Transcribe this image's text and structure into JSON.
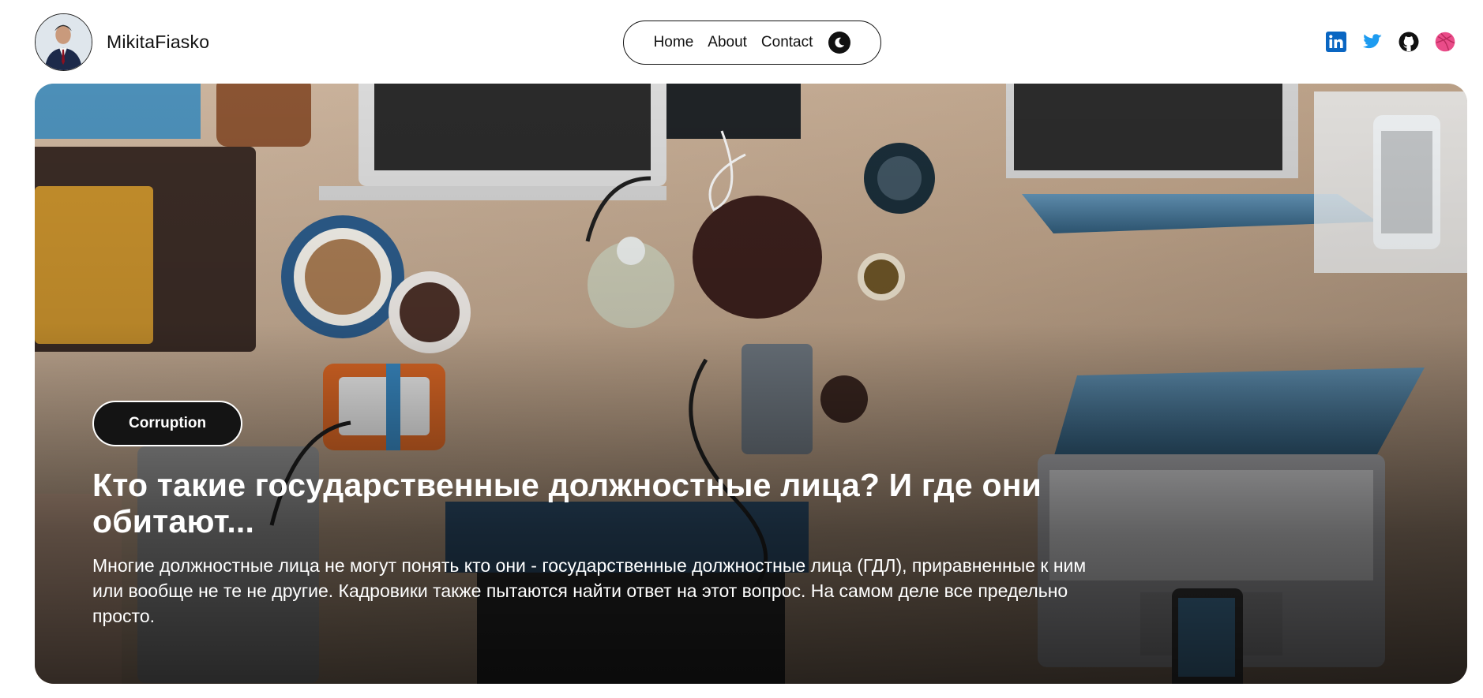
{
  "header": {
    "brand_name": "MikitaFiasko",
    "nav": [
      {
        "label": "Home"
      },
      {
        "label": "About"
      },
      {
        "label": "Contact"
      }
    ],
    "theme_toggle_icon": "moon-icon",
    "socials": [
      {
        "name": "linkedin-icon",
        "color": "#0a66c2"
      },
      {
        "name": "twitter-icon",
        "color": "#1d9bf0"
      },
      {
        "name": "github-icon",
        "color": "#111111"
      },
      {
        "name": "dribbble-icon",
        "color": "#ea4c89"
      }
    ]
  },
  "hero": {
    "tag": "Corruption",
    "title": "Кто такие государственные должностные лица? И где они обитают...",
    "excerpt": "Многие должностные лица не могут понять кто они - государственные должностные лица (ГДЛ), приравненные к ним или вообще не те не другие. Кадровики также пытаются найти ответ на этот вопрос. На самом деле все предельно просто."
  },
  "colors": {
    "accent": "#111111",
    "tag_bg": "#141414",
    "background": "#ffffff"
  }
}
